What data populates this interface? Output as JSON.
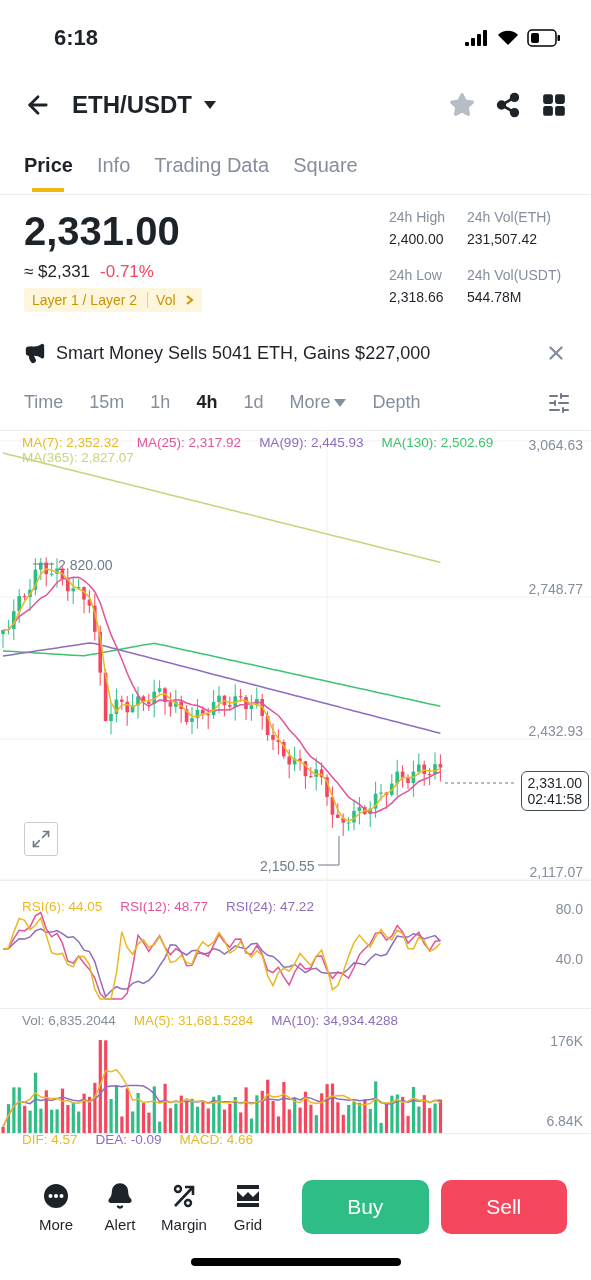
{
  "status_bar": {
    "time": "6:18"
  },
  "header": {
    "pair": "ETH/USDT",
    "favorite": false
  },
  "tabs": [
    {
      "label": "Price",
      "selected": true
    },
    {
      "label": "Info",
      "selected": false
    },
    {
      "label": "Trading Data",
      "selected": false
    },
    {
      "label": "Square",
      "selected": false
    }
  ],
  "price": {
    "last": "2,331.00",
    "approx": "≈ $2,331",
    "change": "-0.71%",
    "tags": [
      "Layer 1 / Layer 2",
      "Vol"
    ]
  },
  "stats": [
    {
      "label": "24h High",
      "value": "2,400.00"
    },
    {
      "label": "24h Vol(ETH)",
      "value": "231,507.42"
    },
    {
      "label": "24h Low",
      "value": "2,318.66"
    },
    {
      "label": "24h Vol(USDT)",
      "value": "544.78M"
    }
  ],
  "news": {
    "text": "Smart Money Sells 5041 ETH, Gains $227,000"
  },
  "intervals": [
    {
      "label": "Time",
      "selected": false
    },
    {
      "label": "15m",
      "selected": false
    },
    {
      "label": "1h",
      "selected": false
    },
    {
      "label": "4h",
      "selected": true
    },
    {
      "label": "1d",
      "selected": false
    },
    {
      "label": "More",
      "selected": false
    },
    {
      "label": "Depth",
      "selected": false
    }
  ],
  "main_chart": {
    "legend": [
      {
        "text": "MA(7): 2,352.32",
        "color": "#e8b923"
      },
      {
        "text": "MA(25): 2,317.92",
        "color": "#e0559a"
      },
      {
        "text": "MA(99): 2,445.93",
        "color": "#8e6cc0"
      },
      {
        "text": "MA(130): 2,502.69",
        "color": "#3cc46e"
      },
      {
        "text": "MA(365): 2,827.07",
        "color": "#c8d47a"
      }
    ],
    "y_axis": [
      "3,064.63",
      "2,748.77",
      "2,432.93",
      "2,117.07"
    ],
    "high_mark": "2,820.00",
    "low_mark": "2,150.55",
    "price_tag": {
      "price": "2,331.00",
      "countdown": "02:41:58"
    }
  },
  "rsi": {
    "legend": [
      {
        "text": "RSI(6): 44.05",
        "color": "#e8b923"
      },
      {
        "text": "RSI(12): 48.77",
        "color": "#e0559a"
      },
      {
        "text": "RSI(24): 47.22",
        "color": "#8e6cc0"
      }
    ],
    "y_axis": [
      "80.0",
      "40.0"
    ]
  },
  "volume": {
    "legend": [
      {
        "text": "Vol: 6,835.2044",
        "color": "#848e9c"
      },
      {
        "text": "MA(5): 31,681.5284",
        "color": "#e8b923"
      },
      {
        "text": "MA(10): 34,934.4288",
        "color": "#8e6cc0"
      }
    ],
    "y_axis": [
      "176K",
      "6.84K"
    ]
  },
  "macd": {
    "legend": [
      {
        "text": "DIF: 4.57",
        "color": "#e8b923"
      },
      {
        "text": "DEA: -0.09",
        "color": "#8e6cc0"
      },
      {
        "text": "MACD: 4.66",
        "color": "#e8b923"
      }
    ]
  },
  "bottom_nav": [
    {
      "label": "More",
      "kind": "more"
    },
    {
      "label": "Alert",
      "kind": "alert"
    },
    {
      "label": "Margin",
      "kind": "margin"
    },
    {
      "label": "Grid",
      "kind": "grid"
    }
  ],
  "actions": [
    {
      "label": "Buy",
      "kind": "buy"
    },
    {
      "label": "Sell",
      "kind": "sell"
    }
  ]
}
